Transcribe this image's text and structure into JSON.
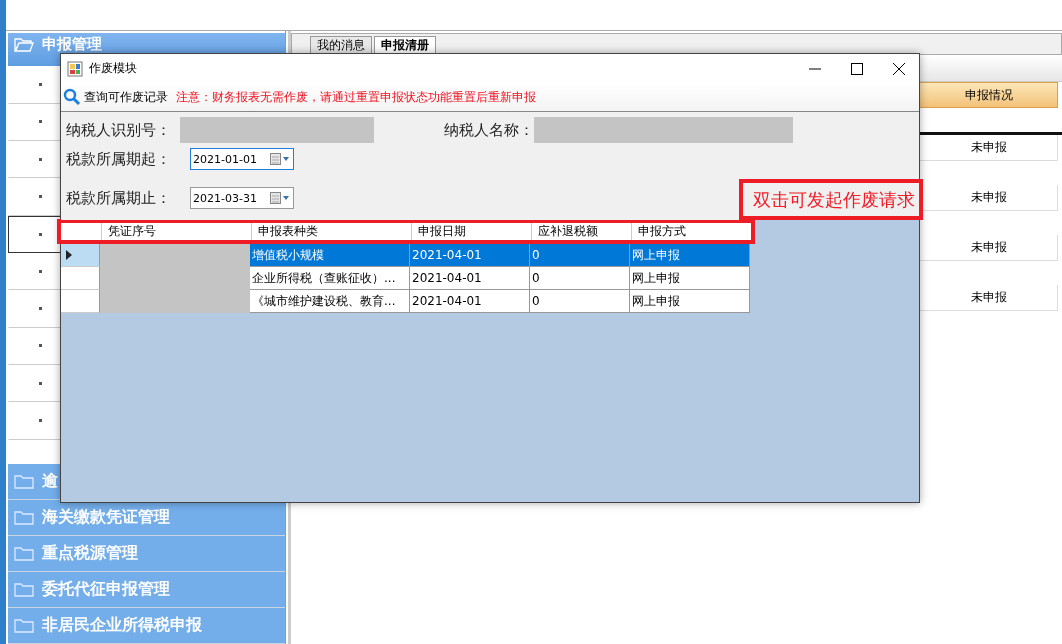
{
  "sidebar": {
    "groups": [
      {
        "label": "申报管理",
        "expanded": true,
        "items": [
          {
            "selected": false
          },
          {
            "selected": false
          },
          {
            "selected": false
          },
          {
            "selected": false
          },
          {
            "selected": true
          },
          {
            "selected": false
          },
          {
            "selected": false
          },
          {
            "selected": false
          },
          {
            "selected": false
          },
          {
            "selected": false
          }
        ]
      },
      {
        "label": "逾",
        "expanded": false
      },
      {
        "label": "海关缴款凭证管理",
        "expanded": false
      },
      {
        "label": "重点税源管理",
        "expanded": false
      },
      {
        "label": "委托代征申报管理",
        "expanded": false
      },
      {
        "label": "非居民企业所得税申报",
        "expanded": false
      }
    ]
  },
  "tabs": [
    {
      "label": "我的消息",
      "selected": false
    },
    {
      "label": "申报清册",
      "selected": true
    }
  ],
  "table": {
    "columns": [
      "申报情况"
    ],
    "rows": [
      [
        "未申报"
      ],
      [
        "未申报"
      ],
      [
        "未申报"
      ],
      [
        "未申报"
      ]
    ]
  },
  "dialog": {
    "title": "作废模块",
    "toolbar": {
      "query_button": "查询可作废记录",
      "notice": "注意：财务报表无需作废，请通过重置申报状态功能重置后重新申报"
    },
    "fields": [
      {
        "label": "纳税人识别号：",
        "kind": "redacted"
      },
      {
        "label": "纳税人名称：",
        "kind": "redacted"
      }
    ],
    "period_start": {
      "label": "税款所属期起：",
      "value": "2021-01-01",
      "focused": true
    },
    "period_end": {
      "label": "税款所属期止：",
      "value": "2021-03-31",
      "focused": false
    },
    "hint": "双击可发起作废请求",
    "grid": {
      "columns": [
        "凭证序号",
        "申报表种类",
        "申报日期",
        "应补退税额",
        "申报方式"
      ],
      "rows": [
        {
          "selected": true,
          "cells": [
            null,
            "增值税小规模",
            "2021-04-01",
            "0",
            "网上申报"
          ]
        },
        {
          "selected": false,
          "cells": [
            null,
            "企业所得税（查账征收）...",
            "2021-04-01",
            "0",
            "网上申报"
          ]
        },
        {
          "selected": false,
          "cells": [
            null,
            "《城市维护建设税、教育...",
            "2021-04-01",
            "0",
            "网上申报"
          ]
        }
      ]
    }
  }
}
